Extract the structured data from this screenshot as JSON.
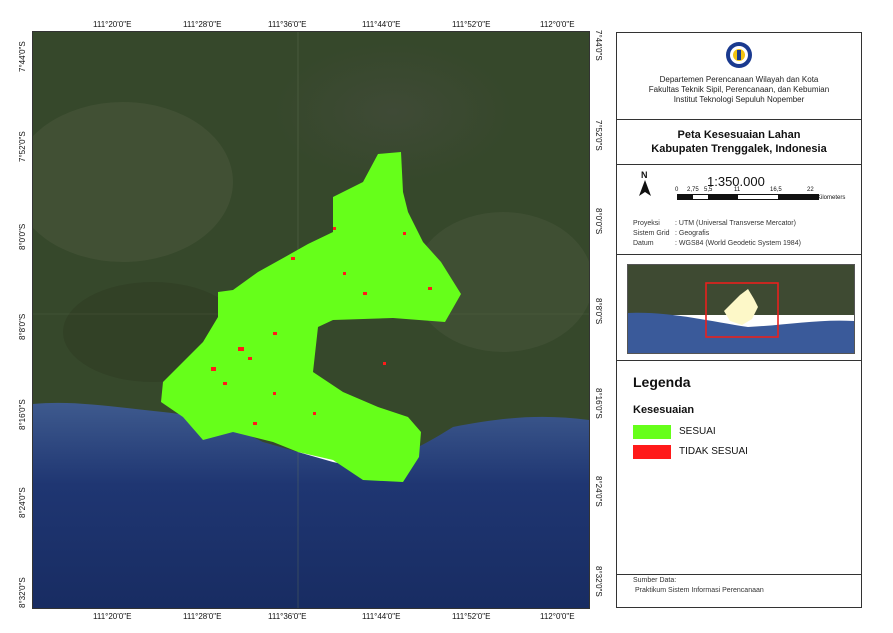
{
  "colors": {
    "sesuai": "#66ff1a",
    "tidak_sesuai": "#ff1a1a",
    "sea": "#233a7a",
    "land_dark": "#2f3d22",
    "inset_frame": "#e8201d",
    "inset_region": "#fdf8c8"
  },
  "axes": {
    "top_ticks": [
      "111°20'0\"E",
      "111°28'0\"E",
      "111°36'0\"E",
      "111°44'0\"E",
      "111°52'0\"E",
      "112°0'0\"E"
    ],
    "bottom_ticks": [
      "111°20'0\"E",
      "111°28'0\"E",
      "111°36'0\"E",
      "111°44'0\"E",
      "111°52'0\"E",
      "112°0'0\"E"
    ],
    "left_ticks": [
      "7°44'0\"S",
      "7°52'0\"S",
      "8°0'0\"S",
      "8°8'0\"S",
      "8°16'0\"S",
      "8°24'0\"S",
      "8°32'0\"S"
    ],
    "right_ticks": [
      "7°44'0\"S",
      "7°52'0\"S",
      "8°0'0\"S",
      "8°8'0\"S",
      "8°16'0\"S",
      "8°24'0\"S",
      "8°32'0\"S"
    ]
  },
  "header": {
    "logo": "its-logo-icon",
    "dept": "Departemen Perencanaan Wilayah dan Kota",
    "faculty": "Fakultas Teknik Sipil, Perencanaan, dan Kebumian",
    "institute": "Institut Teknologi Sepuluh Nopember"
  },
  "title": {
    "line1": "Peta Kesesuaian Lahan",
    "line2": "Kabupaten Trenggalek, Indonesia"
  },
  "scale": {
    "north_label": "N",
    "ratio": "1:350.000",
    "bar_labels": [
      "0",
      "2,75",
      "5,5",
      "11",
      "16,5",
      "22"
    ],
    "unit": "Kilometers"
  },
  "info": [
    {
      "key": "Proyeksi",
      "value": ": UTM (Universal Transverse Mercator)"
    },
    {
      "key": "Sistem Grid",
      "value": ": Geografis"
    },
    {
      "key": "Datum",
      "value": ": WGS84 (World Geodetic System 1984)"
    }
  ],
  "legend": {
    "title": "Legenda",
    "subtitle": "Kesesuaian",
    "items": [
      {
        "label": "SESUAI"
      },
      {
        "label": "TIDAK SESUAI"
      }
    ]
  },
  "source": {
    "label": "Sumber Data:",
    "value": "Praktikum Sistem Informasi Perencanaan"
  }
}
